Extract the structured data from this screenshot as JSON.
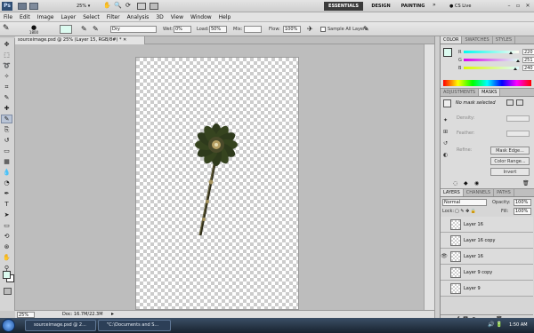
{
  "app": {
    "logo": "Ps",
    "zoom": "25%",
    "workspaces": [
      "ESSENTIALS",
      "DESIGN",
      "PAINTING"
    ],
    "cs_live": "CS Live"
  },
  "menu": [
    "File",
    "Edit",
    "Image",
    "Layer",
    "Select",
    "Filter",
    "Analysis",
    "3D",
    "View",
    "Window",
    "Help"
  ],
  "options": {
    "brush_size": "1800",
    "mode": "Dry",
    "wet_label": "Wet:",
    "wet_value": "0%",
    "load_label": "Load:",
    "load_value": "50%",
    "mix_label": "Mix:",
    "flow_label": "Flow:",
    "flow_value": "100%",
    "sample_label": "Sample All Layers"
  },
  "document": {
    "tab_title": "sourceimage.psd @ 25% (Layer 15, RGB/8#) *",
    "zoom": "25%",
    "doc_info": "Doc: 16.7M/22.3M"
  },
  "tools": [
    "move",
    "marquee",
    "lasso",
    "quick-select",
    "crop",
    "eyedropper",
    "healing",
    "brush",
    "clone",
    "history",
    "eraser",
    "gradient",
    "blur",
    "dodge",
    "pen",
    "type",
    "path-select",
    "shape",
    "3d-rotate",
    "3d-orbit",
    "hand",
    "zoom"
  ],
  "color_panel": {
    "tabs": [
      "COLOR",
      "SWATCHES",
      "STYLES"
    ],
    "sliders": [
      {
        "label": "R",
        "value": "220",
        "fraction": 0.86,
        "gradient": "linear-gradient(90deg,#00fbf0,#fffbf0)"
      },
      {
        "label": "G",
        "value": "251",
        "fraction": 0.98,
        "gradient": "linear-gradient(90deg,#dc00f0,#dcfff0)"
      },
      {
        "label": "B",
        "value": "240",
        "fraction": 0.94,
        "gradient": "linear-gradient(90deg,#dcfb00,#dcfbff)"
      }
    ],
    "foreground": "#dcfbf0"
  },
  "adjust_panel": {
    "tabs": [
      "ADJUSTMENTS",
      "MASKS"
    ],
    "status": "No mask selected",
    "density": "Density:",
    "feather": "Feather:",
    "refine": "Refine:",
    "btn_mask_edge": "Mask Edge...",
    "btn_color_range": "Color Range...",
    "btn_invert": "Invert"
  },
  "layers_panel": {
    "tabs": [
      "LAYERS",
      "CHANNELS",
      "PATHS"
    ],
    "blend_mode": "Normal",
    "opacity_label": "Opacity:",
    "opacity": "100%",
    "lock_label": "Lock:",
    "fill_label": "Fill:",
    "fill": "100%",
    "layers": [
      {
        "name": "Layer 16",
        "visible": false,
        "active": false
      },
      {
        "name": "Layer 16 copy",
        "visible": false,
        "active": false
      },
      {
        "name": "Layer 16",
        "visible": true,
        "active": false
      },
      {
        "name": "Layer 9 copy",
        "visible": false,
        "active": false
      },
      {
        "name": "Layer 9",
        "visible": false,
        "active": false
      }
    ]
  },
  "taskbar": {
    "items": [
      "sourceimage.psd @ 2...",
      "\"C:\\Documents and S..."
    ],
    "clock": "1:50 AM"
  }
}
